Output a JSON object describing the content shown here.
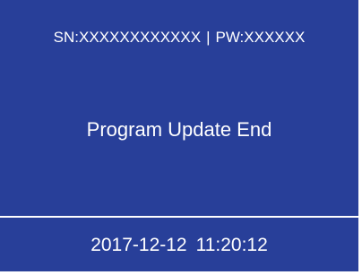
{
  "header": {
    "serial": "SN:XXXXXXXXXXXX",
    "separator": "|",
    "password": "PW:XXXXXX"
  },
  "message": "Program Update End",
  "footer": {
    "date": "2017-12-12",
    "time": "11:20:12"
  },
  "colors": {
    "background": "#283f99",
    "text": "#ffffff"
  }
}
